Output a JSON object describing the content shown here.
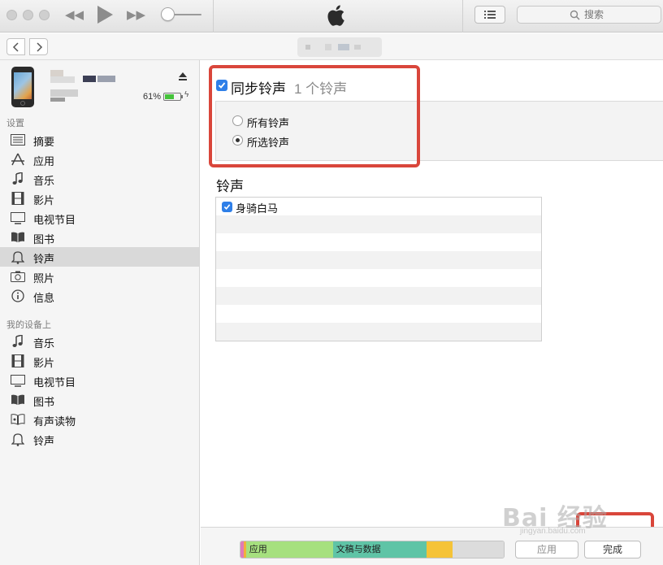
{
  "toolbar": {
    "search_placeholder": "搜索"
  },
  "device": {
    "battery_text": "61%",
    "battery_level": 0.61
  },
  "sidebar": {
    "settings_title": "设置",
    "settings_items": [
      {
        "label": "摘要",
        "icon": "summary-icon"
      },
      {
        "label": "应用",
        "icon": "apps-icon"
      },
      {
        "label": "音乐",
        "icon": "music-icon"
      },
      {
        "label": "影片",
        "icon": "film-icon"
      },
      {
        "label": "电视节目",
        "icon": "tv-icon"
      },
      {
        "label": "图书",
        "icon": "book-icon"
      },
      {
        "label": "铃声",
        "icon": "bell-icon",
        "selected": true
      },
      {
        "label": "照片",
        "icon": "camera-icon"
      },
      {
        "label": "信息",
        "icon": "info-icon"
      }
    ],
    "on_device_title": "我的设备上",
    "device_items": [
      {
        "label": "音乐",
        "icon": "music-icon"
      },
      {
        "label": "影片",
        "icon": "film-icon"
      },
      {
        "label": "电视节目",
        "icon": "tv-icon"
      },
      {
        "label": "图书",
        "icon": "book-icon"
      },
      {
        "label": "有声读物",
        "icon": "audiobook-icon"
      },
      {
        "label": "铃声",
        "icon": "bell-icon"
      }
    ]
  },
  "main": {
    "sync_checked": true,
    "sync_label": "同步铃声",
    "sync_count": "1 个铃声",
    "radio_all": "所有铃声",
    "radio_selected": "所选铃声",
    "radio_value": "selected",
    "section_title": "铃声",
    "ringtones": [
      {
        "name": "身骑白马",
        "checked": true
      }
    ]
  },
  "bottombar": {
    "storage_segments": [
      {
        "label": "",
        "color": "#e07ab8",
        "fraction": 0.012
      },
      {
        "label": "",
        "color": "#f0b13a",
        "fraction": 0.009
      },
      {
        "label": "应用",
        "color": "#a6e07f",
        "fraction": 0.33
      },
      {
        "label": "文稿与数据",
        "color": "#5fc4a6",
        "fraction": 0.355
      },
      {
        "label": "",
        "color": "#f5c338",
        "fraction": 0.1
      },
      {
        "label": "",
        "color": "#dcdcdc",
        "fraction": 0.194
      }
    ],
    "apply_label": "应用",
    "done_label": "完成"
  },
  "watermark": {
    "text": "Bai 经验",
    "sub": "jingyan.baidu.com"
  },
  "colors": {
    "accent": "#2e7fe8",
    "annotation": "#d9463b",
    "selected_row": "#d9d9d9"
  }
}
